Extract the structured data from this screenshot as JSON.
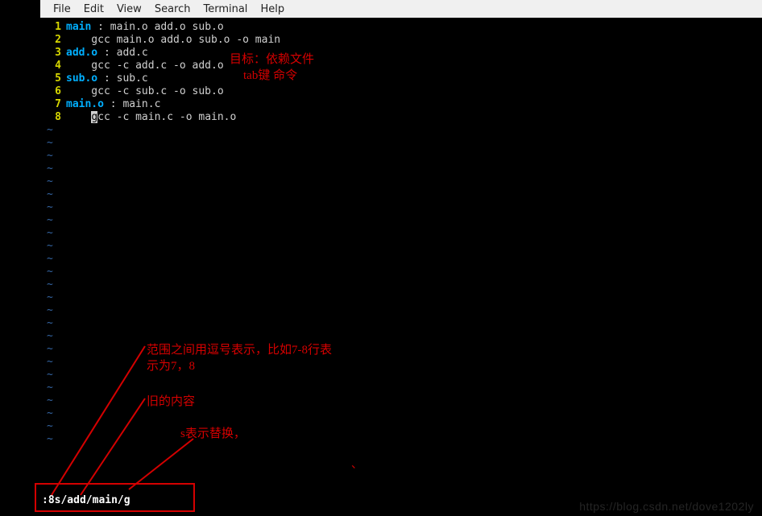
{
  "menubar": {
    "file": "File",
    "edit": "Edit",
    "view": "View",
    "search": "Search",
    "terminal": "Terminal",
    "help": "Help"
  },
  "code_lines": [
    {
      "num": "1",
      "gutter": "  1",
      "segments": [
        {
          "t": "main ",
          "cls": "kw-target"
        },
        {
          "t": ": ",
          "cls": "punct"
        },
        {
          "t": "main.o add.o sub.o",
          "cls": "kw-plain"
        }
      ]
    },
    {
      "num": "2",
      "gutter": "  2",
      "segments": [
        {
          "t": "    gcc main.o add.o sub.o -o main",
          "cls": "kw-plain"
        }
      ]
    },
    {
      "num": "3",
      "gutter": "  3",
      "segments": [
        {
          "t": "add.o ",
          "cls": "kw-target"
        },
        {
          "t": ": ",
          "cls": "punct"
        },
        {
          "t": "add.c",
          "cls": "kw-plain"
        }
      ]
    },
    {
      "num": "4",
      "gutter": "  4",
      "segments": [
        {
          "t": "    gcc -c add.c -o add.o",
          "cls": "kw-plain"
        }
      ]
    },
    {
      "num": "5",
      "gutter": "  5",
      "segments": [
        {
          "t": "sub.o ",
          "cls": "kw-target"
        },
        {
          "t": ": ",
          "cls": "punct"
        },
        {
          "t": "sub.c",
          "cls": "kw-plain"
        }
      ]
    },
    {
      "num": "6",
      "gutter": "  6",
      "segments": [
        {
          "t": "    gcc -c sub.c -o sub.o",
          "cls": "kw-plain"
        }
      ]
    },
    {
      "num": "7",
      "gutter": "  7",
      "segments": [
        {
          "t": "main.o ",
          "cls": "kw-target"
        },
        {
          "t": ": ",
          "cls": "punct"
        },
        {
          "t": "main.c",
          "cls": "kw-plain"
        }
      ]
    },
    {
      "num": "8",
      "gutter": "  8",
      "segments": [
        {
          "t": "    ",
          "cls": "kw-plain"
        },
        {
          "t": "g",
          "cls": "cursor-cell"
        },
        {
          "t": "cc -c main.c -o main.o",
          "cls": "kw-plain"
        }
      ]
    }
  ],
  "tilde_count": 25,
  "tilde_char": "~",
  "cmdline": ":8s/add/main/g",
  "annotations": {
    "a1": "目标：依赖文件",
    "a2": "tab键 命令",
    "a3": "范围之间用逗号表示，比如7-8行表",
    "a3b": "示为7，8",
    "a4": "旧的内容",
    "a5": "s表示替换，"
  },
  "watermark": "https://blog.csdn.net/dove1202ly"
}
